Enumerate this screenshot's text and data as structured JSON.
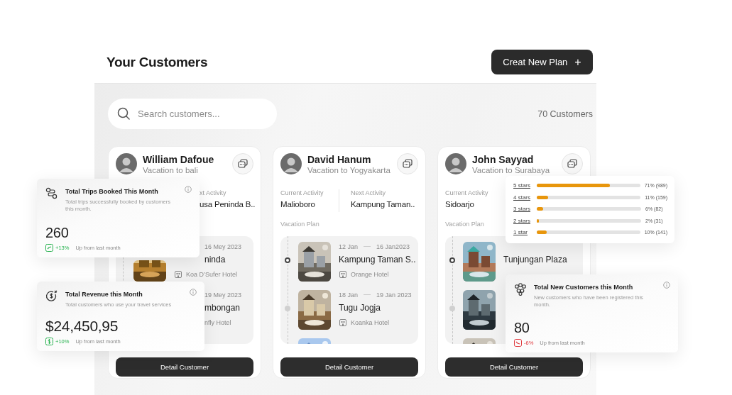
{
  "header": {
    "title": "Your Customers",
    "create_button": {
      "label": "Creat New Plan",
      "icon": "+"
    }
  },
  "search": {
    "placeholder": "Search customers..."
  },
  "customer_count": "70 Customers",
  "customers": [
    {
      "name": "William Dafoue",
      "trip": "Vacation to bali",
      "next_activity": {
        "label": "xt Activity",
        "value": "usa Peninda B.."
      },
      "plan": [
        {
          "kind": "picture",
          "end": "16 Mey 2023",
          "place": "ninda",
          "hotel": "Koa D’Sufer Hotel"
        },
        {
          "kind": "text",
          "end": "19 Mey 2023",
          "place": "mbongan",
          "hotel": "nfly Hotel"
        }
      ],
      "button": "Detail Customer"
    },
    {
      "name": "David Hanum",
      "trip": "Vacation to Yogyakarta",
      "current_activity": {
        "label": "Current Activity",
        "value": "Malioboro"
      },
      "next_activity": {
        "label": "Next Activity",
        "value": "Kampung Taman.."
      },
      "plan_label": "Vacation Plan",
      "plan": [
        {
          "kind": "picture",
          "start": "12 Jan",
          "end": "16 Jan2023",
          "place": "Kampung Taman S..",
          "hotel": "Orange Hotel"
        },
        {
          "kind": "picture",
          "start": "18 Jan",
          "end": "19 Jan 2023",
          "place": "Tugu Jogja",
          "hotel": "Koanka Hotel"
        },
        {
          "kind": "picture"
        }
      ],
      "button": "Detail Customer"
    },
    {
      "name": "John Sayyad",
      "trip": "Vacation to Surabaya",
      "current_activity": {
        "label": "Current Activity",
        "value": "Sidoarjo"
      },
      "plan_label": "Vacation Plan",
      "plan": [
        {
          "kind": "picture",
          "place": "Tunjungan Plaza"
        },
        {
          "kind": "picture"
        },
        {
          "kind": "picture"
        }
      ],
      "button": "Detail Customer"
    }
  ],
  "stats": [
    {
      "kind": "trips",
      "title": "Total Trips Booked This Month",
      "description": "Total trips successfully booked by customers this month.",
      "value": "260",
      "color": "#22b04b",
      "change": "+13%",
      "note": "Up from last month"
    },
    {
      "kind": "revenue",
      "title": "Total Revenue this Month",
      "description": "Total customers who use your travel services",
      "value": "$24,450,95",
      "color": "#22b04b",
      "change": "+10%",
      "note": "Up from last month"
    },
    {
      "kind": "customers",
      "title": "Total New Customers this Month",
      "description": "New customers who have been registered this month.",
      "value": "80",
      "color": "#e0393e",
      "change": "-6%",
      "note": "Up from last month"
    }
  ],
  "ratings": [
    {
      "label": "5 stars",
      "level": 0.71,
      "reading": "71% (989)"
    },
    {
      "label": "4 stars",
      "level": 0.11,
      "reading": "11% (159)"
    },
    {
      "label": "3 stars",
      "level": 0.06,
      "reading": "6% (82)"
    },
    {
      "label": "2 stars",
      "level": 0.02,
      "reading": "2% (31)"
    },
    {
      "label": "1 star",
      "level": 0.1,
      "reading": "10% (141)"
    }
  ]
}
